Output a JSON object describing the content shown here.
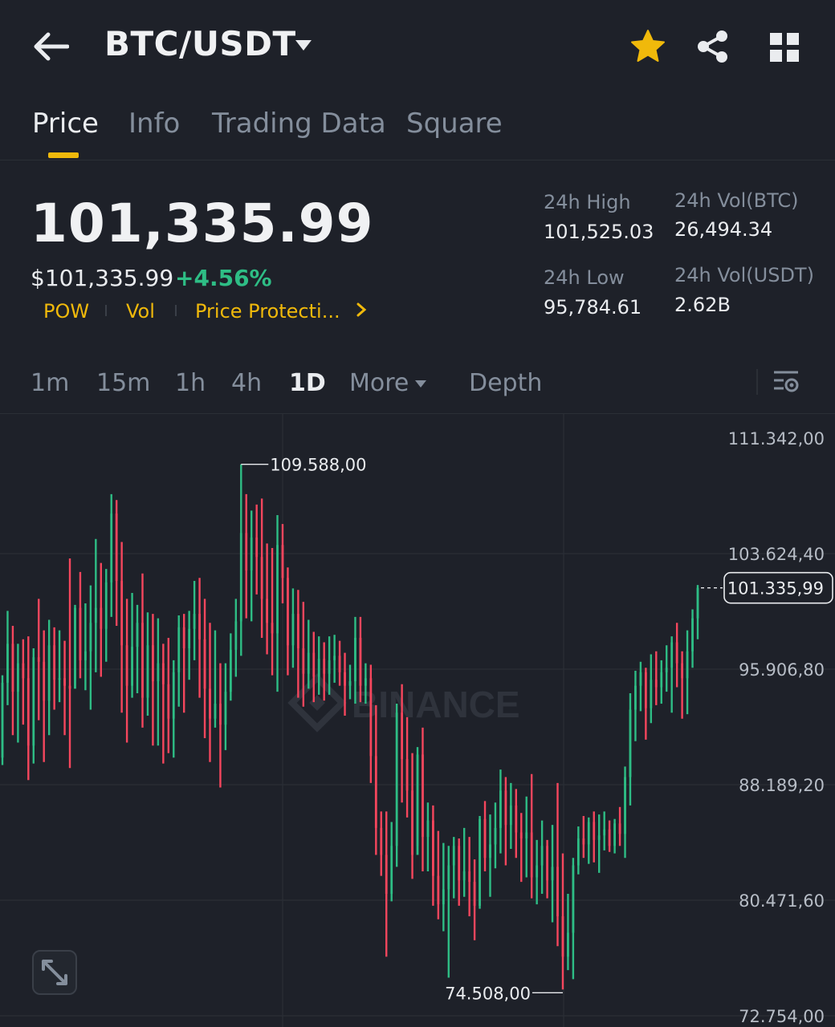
{
  "header": {
    "title": "BTC/USDT",
    "icons": [
      "back-arrow-icon",
      "caret-down-icon",
      "star-icon",
      "share-icon",
      "grid-icon"
    ]
  },
  "tabs": [
    {
      "label": "Price",
      "active": true
    },
    {
      "label": "Info",
      "active": false
    },
    {
      "label": "Trading Data",
      "active": false
    },
    {
      "label": "Square",
      "active": false
    }
  ],
  "ticker": {
    "last_price": "101,335.99",
    "usd_price": "$101,335.99",
    "change_pct": "+4.56%",
    "tags": [
      "POW",
      "Vol",
      "Price Protecti..."
    ],
    "high_label": "24h High",
    "high_value": "101,525.03",
    "low_label": "24h Low",
    "low_value": "95,784.61",
    "vol_btc_label": "24h Vol(BTC)",
    "vol_btc_value": "26,494.34",
    "vol_usdt_label": "24h Vol(USDT)",
    "vol_usdt_value": "2.62B"
  },
  "timeframes": [
    {
      "label": "1m",
      "active": false
    },
    {
      "label": "15m",
      "active": false
    },
    {
      "label": "1h",
      "active": false
    },
    {
      "label": "4h",
      "active": false
    },
    {
      "label": "1D",
      "active": true
    },
    {
      "label": "More",
      "active": false
    },
    {
      "label": "Depth",
      "active": false
    }
  ],
  "colors": {
    "up": "#2ebd85",
    "down": "#f6465d",
    "accent": "#f0b90b",
    "background": "#1e2129",
    "grid": "#2b2f36",
    "muted": "#848e9c"
  },
  "chart_data": {
    "type": "ohlc",
    "y_ticks": [
      "111.342,00",
      "103.624,40",
      "95.906,80",
      "88.189,20",
      "80.471,60",
      "72.754,00"
    ],
    "y_tick_values": [
      111342.0,
      103624.4,
      95906.8,
      88189.2,
      80471.6,
      72754.0
    ],
    "ylim": [
      72754.0,
      111342.0
    ],
    "max_label": "109.588,00",
    "min_label": "74.508,00",
    "current_label": "101.335,99",
    "current_value": 101335.99,
    "watermark": "BINANCE",
    "candles": [
      [
        90000,
        95500,
        89500,
        95000
      ],
      [
        95000,
        99800,
        93500,
        97600
      ],
      [
        97600,
        98800,
        91500,
        94400
      ],
      [
        94400,
        97600,
        91000,
        96300
      ],
      [
        96300,
        97900,
        92200,
        95300
      ],
      [
        95300,
        98100,
        88500,
        90800
      ],
      [
        90800,
        97300,
        89600,
        96700
      ],
      [
        96700,
        100600,
        92500,
        96400
      ],
      [
        96400,
        98500,
        89700,
        93800
      ],
      [
        93800,
        99200,
        91500,
        97500
      ],
      [
        97500,
        98700,
        93200,
        95200
      ],
      [
        95200,
        98500,
        93700,
        95300
      ],
      [
        95300,
        97800,
        91500,
        94800
      ],
      [
        94800,
        103300,
        89300,
        94600
      ],
      [
        94600,
        100200,
        95200,
        100000
      ],
      [
        100000,
        102400,
        95300,
        96500
      ],
      [
        96500,
        100300,
        94500,
        97100
      ],
      [
        97100,
        101500,
        93200,
        99000
      ],
      [
        99000,
        104600,
        95700,
        100000
      ],
      [
        100000,
        103000,
        95400,
        98600
      ],
      [
        98600,
        102600,
        96400,
        101700
      ],
      [
        101700,
        107600,
        99400,
        106300
      ],
      [
        106300,
        107200,
        98800,
        101800
      ],
      [
        101800,
        104400,
        93000,
        97500
      ],
      [
        97500,
        100600,
        91000,
        94800
      ],
      [
        94800,
        101000,
        94000,
        97400
      ],
      [
        97400,
        100200,
        94300,
        99000
      ],
      [
        99000,
        102300,
        92000,
        94000
      ],
      [
        94000,
        99700,
        92800,
        97500
      ],
      [
        97500,
        99600,
        90800,
        95100
      ],
      [
        95100,
        99300,
        90800,
        96300
      ],
      [
        96300,
        97600,
        89600,
        94900
      ],
      [
        94900,
        98000,
        90300,
        92600
      ],
      [
        92600,
        96500,
        90000,
        95700
      ],
      [
        95700,
        99500,
        93400,
        98700
      ],
      [
        98700,
        99600,
        93000,
        97300
      ],
      [
        97300,
        99800,
        95200,
        98600
      ],
      [
        98600,
        101800,
        96500,
        99600
      ],
      [
        99600,
        102000,
        94000,
        97900
      ],
      [
        97900,
        100600,
        91300,
        94600
      ],
      [
        94600,
        99000,
        89700,
        92600
      ],
      [
        92600,
        98500,
        92000,
        93600
      ],
      [
        93600,
        96300,
        88000,
        92200
      ],
      [
        92200,
        96300,
        90500,
        94400
      ],
      [
        94400,
        98300,
        93800,
        97200
      ],
      [
        97200,
        100600,
        95400,
        99100
      ],
      [
        99100,
        109588,
        96800,
        105000
      ],
      [
        105000,
        107600,
        99300,
        102500
      ],
      [
        102500,
        106500,
        99100,
        104700
      ],
      [
        104700,
        106900,
        100900,
        103400
      ],
      [
        103400,
        107300,
        98000,
        100600
      ],
      [
        100600,
        104300,
        96900,
        99000
      ],
      [
        99000,
        104000,
        95500,
        98300
      ],
      [
        98300,
        106200,
        94400,
        104200
      ],
      [
        104200,
        105600,
        100300,
        102000
      ],
      [
        102000,
        102700,
        95500,
        97500
      ],
      [
        97500,
        101300,
        96000,
        99600
      ],
      [
        99600,
        101200,
        94000,
        97300
      ],
      [
        97300,
        100400,
        93400,
        95600
      ],
      [
        95600,
        99200,
        94600,
        97000
      ],
      [
        97000,
        98400,
        93700,
        95400
      ],
      [
        95400,
        98100,
        94200,
        96600
      ],
      [
        96600,
        97700,
        93800,
        95600
      ],
      [
        95600,
        98100,
        94200,
        96500
      ],
      [
        96500,
        98200,
        95000,
        96800
      ],
      [
        96800,
        97800,
        94800,
        95700
      ],
      [
        95700,
        97000,
        92800,
        94800
      ],
      [
        94800,
        96200,
        93900,
        95100
      ],
      [
        95100,
        99400,
        93600,
        98000
      ],
      [
        98000,
        99400,
        93700,
        94800
      ],
      [
        94800,
        96300,
        93600,
        95300
      ],
      [
        95300,
        96200,
        88300,
        90100
      ],
      [
        90100,
        93500,
        83500,
        85300
      ],
      [
        85300,
        86400,
        82100,
        83500
      ],
      [
        83500,
        86400,
        76700,
        80900
      ],
      [
        80900,
        85700,
        80400,
        84100
      ],
      [
        84100,
        93600,
        82700,
        93000
      ],
      [
        93000,
        94900,
        87000,
        89900
      ],
      [
        89900,
        92700,
        86000,
        87800
      ],
      [
        87800,
        90300,
        81900,
        83500
      ],
      [
        83500,
        90700,
        84100,
        90200
      ],
      [
        90200,
        92000,
        82400,
        84700
      ],
      [
        84700,
        87000,
        82400,
        85800
      ],
      [
        85800,
        86800,
        80100,
        82100
      ],
      [
        82100,
        85100,
        79200,
        80200
      ],
      [
        80200,
        84300,
        78400,
        81200
      ],
      [
        81200,
        84100,
        75300,
        82800
      ],
      [
        82800,
        84700,
        80600,
        84100
      ],
      [
        84100,
        84600,
        80100,
        81800
      ],
      [
        81800,
        85300,
        80700,
        82400
      ],
      [
        82400,
        84700,
        79400,
        81700
      ],
      [
        81700,
        83200,
        77800,
        80100
      ],
      [
        80100,
        86100,
        79900,
        85900
      ],
      [
        85900,
        87100,
        82400,
        83300
      ],
      [
        83300,
        86200,
        80700,
        84200
      ],
      [
        84200,
        87000,
        82600,
        85300
      ],
      [
        85300,
        89200,
        83600,
        87800
      ],
      [
        87800,
        88700,
        82800,
        85500
      ],
      [
        85500,
        88300,
        83900,
        86800
      ],
      [
        86800,
        87900,
        83300,
        85000
      ],
      [
        85000,
        86300,
        81700,
        84600
      ],
      [
        84600,
        87400,
        82000,
        85000
      ],
      [
        85000,
        88900,
        80600,
        82000
      ],
      [
        82000,
        84500,
        80200,
        82800
      ],
      [
        82800,
        85800,
        80900,
        84100
      ],
      [
        84100,
        84500,
        80600,
        81800
      ],
      [
        81800,
        85500,
        79000,
        82700
      ],
      [
        82700,
        88300,
        77400,
        79400
      ],
      [
        79400,
        83600,
        74508,
        76700
      ],
      [
        76700,
        80900,
        75800,
        78300
      ],
      [
        78300,
        83300,
        75200,
        82800
      ],
      [
        82800,
        85400,
        82200,
        84600
      ],
      [
        84600,
        86100,
        83300,
        84200
      ],
      [
        84200,
        86000,
        82900,
        85700
      ],
      [
        85700,
        86400,
        83000,
        84500
      ],
      [
        84500,
        86200,
        82300,
        84800
      ],
      [
        84800,
        86400,
        83800,
        85200
      ],
      [
        85200,
        85800,
        83700,
        84100
      ],
      [
        84100,
        85900,
        83600,
        85600
      ],
      [
        85600,
        86700,
        84100,
        84900
      ],
      [
        84900,
        89400,
        83300,
        88700
      ],
      [
        88700,
        94300,
        86800,
        93200
      ],
      [
        93200,
        95800,
        91100,
        94800
      ],
      [
        94800,
        96400,
        93100,
        95700
      ],
      [
        95700,
        96000,
        91200,
        93300
      ],
      [
        93300,
        96900,
        92300,
        95200
      ],
      [
        95200,
        97100,
        93500,
        94700
      ],
      [
        94700,
        96500,
        93600,
        95700
      ],
      [
        95700,
        97500,
        94400,
        96000
      ],
      [
        96000,
        98100,
        93000,
        97700
      ],
      [
        97700,
        99000,
        94700,
        96300
      ],
      [
        96300,
        97100,
        92600,
        95300
      ],
      [
        95300,
        98500,
        92900,
        97100
      ],
      [
        97100,
        99900,
        96000,
        99300
      ],
      [
        99300,
        101525,
        97900,
        101336
      ]
    ]
  }
}
